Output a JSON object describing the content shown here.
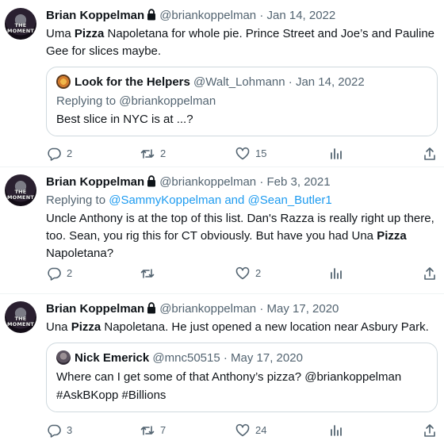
{
  "tweets": [
    {
      "author": {
        "name": "Brian Koppelman",
        "handle": "@briankoppelman",
        "avatar_caption": "THE MOMENT"
      },
      "date": "Jan 14, 2022",
      "body_lines": [
        [
          "Uma ",
          "Pizza",
          " Napoletana for whole pie. Prince Street and Joe’s and Pauline"
        ],
        [
          "Gee for slices maybe."
        ]
      ],
      "quote": {
        "author": "Look for the Helpers",
        "handle": "@Walt_Lohmann",
        "date": "Jan 14, 2022",
        "replying_to": "Replying to @briankoppelman",
        "text": "Best slice in NYC is at ...?"
      },
      "stats": {
        "replies": "2",
        "retweets": "2",
        "likes": "15"
      }
    },
    {
      "author": {
        "name": "Brian Koppelman",
        "handle": "@briankoppelman",
        "avatar_caption": "THE MOMENT"
      },
      "date": "Feb 3, 2021",
      "replying_prefix": "Replying to ",
      "replying_handles": "@SammyKoppelman and @Sean_Butler1",
      "body_lines": [
        [
          "Uncle Anthony is at the top of this list. Dan's Razza is really right up there,"
        ],
        [
          "too. Sean, you rig this for CT obviously. But have you had Una ",
          "Pizza",
          ""
        ],
        [
          "Napoletana?"
        ]
      ],
      "stats": {
        "replies": "2",
        "retweets": "",
        "likes": "2"
      }
    },
    {
      "author": {
        "name": "Brian Koppelman",
        "handle": "@briankoppelman",
        "avatar_caption": "THE MOMENT"
      },
      "date": "May 17, 2020",
      "body_lines": [
        [
          "Una ",
          "Pizza",
          " Napoletana. He just opened a new location near Asbury Park."
        ]
      ],
      "quote": {
        "author": "Nick Emerick",
        "handle": "@mnc50515",
        "date": "May 17, 2020",
        "lines": [
          "Where can I get some of that Anthony’s pizza? @briankoppelman",
          "#AskBKopp #Billions"
        ]
      },
      "stats": {
        "replies": "3",
        "retweets": "7",
        "likes": "24"
      }
    }
  ],
  "separator": "·",
  "icons": {
    "reply": "speech-bubble-icon",
    "retweet": "retweet-arrows-icon",
    "like": "heart-icon",
    "views": "bar-chart-icon",
    "share": "share-upload-icon",
    "lock": "lock-icon"
  },
  "colors": {
    "text": "#0f1419",
    "muted": "#536471",
    "link": "#1d9bf0",
    "border": "#cfd9de"
  }
}
